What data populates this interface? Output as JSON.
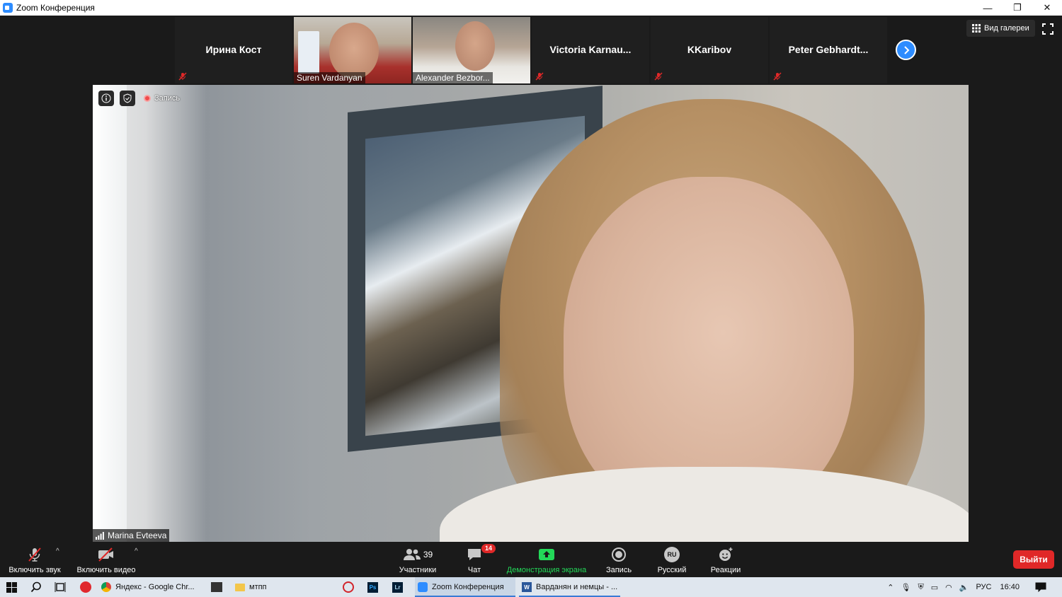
{
  "window": {
    "title": "Zoom Конференция",
    "controls": {
      "minimize": "—",
      "restore": "❐",
      "close": "✕"
    }
  },
  "thumbnails": [
    {
      "name": "Ирина Кост",
      "type": "name",
      "muted": true
    },
    {
      "name": "Suren Vardanyan",
      "type": "video",
      "muted": false
    },
    {
      "name": "Alexander Bezbor...",
      "type": "video",
      "muted": false
    },
    {
      "name": "Victoria  Karnau...",
      "type": "name",
      "muted": true
    },
    {
      "name": "KKaribov",
      "type": "name",
      "muted": true
    },
    {
      "name": "Peter  Gebhardt...",
      "type": "name",
      "muted": true
    }
  ],
  "view": {
    "gallery_label": "Вид галереи"
  },
  "main_video": {
    "speaker_name": "Marina Evteeva",
    "recording_label": "Запись"
  },
  "toolbar": {
    "unmute_label": "Включить звук",
    "start_video_label": "Включить видео",
    "participants_label": "Участники",
    "participants_count": "39",
    "chat_label": "Чат",
    "chat_count": "14",
    "share_label": "Демонстрация экрана",
    "record_label": "Запись",
    "language_label": "Русский",
    "language_code": "RU",
    "reactions_label": "Реакции",
    "leave_label": "Выйти"
  },
  "taskbar": {
    "apps": [
      {
        "label": "Яндекс - Google Chr..."
      },
      {
        "label": "мтпп"
      },
      {
        "label": "Zoom Конференция"
      },
      {
        "label": "Варданян и немцы - ..."
      }
    ],
    "lang": "РУС",
    "time": "16:40"
  },
  "colors": {
    "accent": "#2d8cff",
    "leave": "#e02828",
    "share_green": "#23d959",
    "muted_red": "#e02828"
  }
}
